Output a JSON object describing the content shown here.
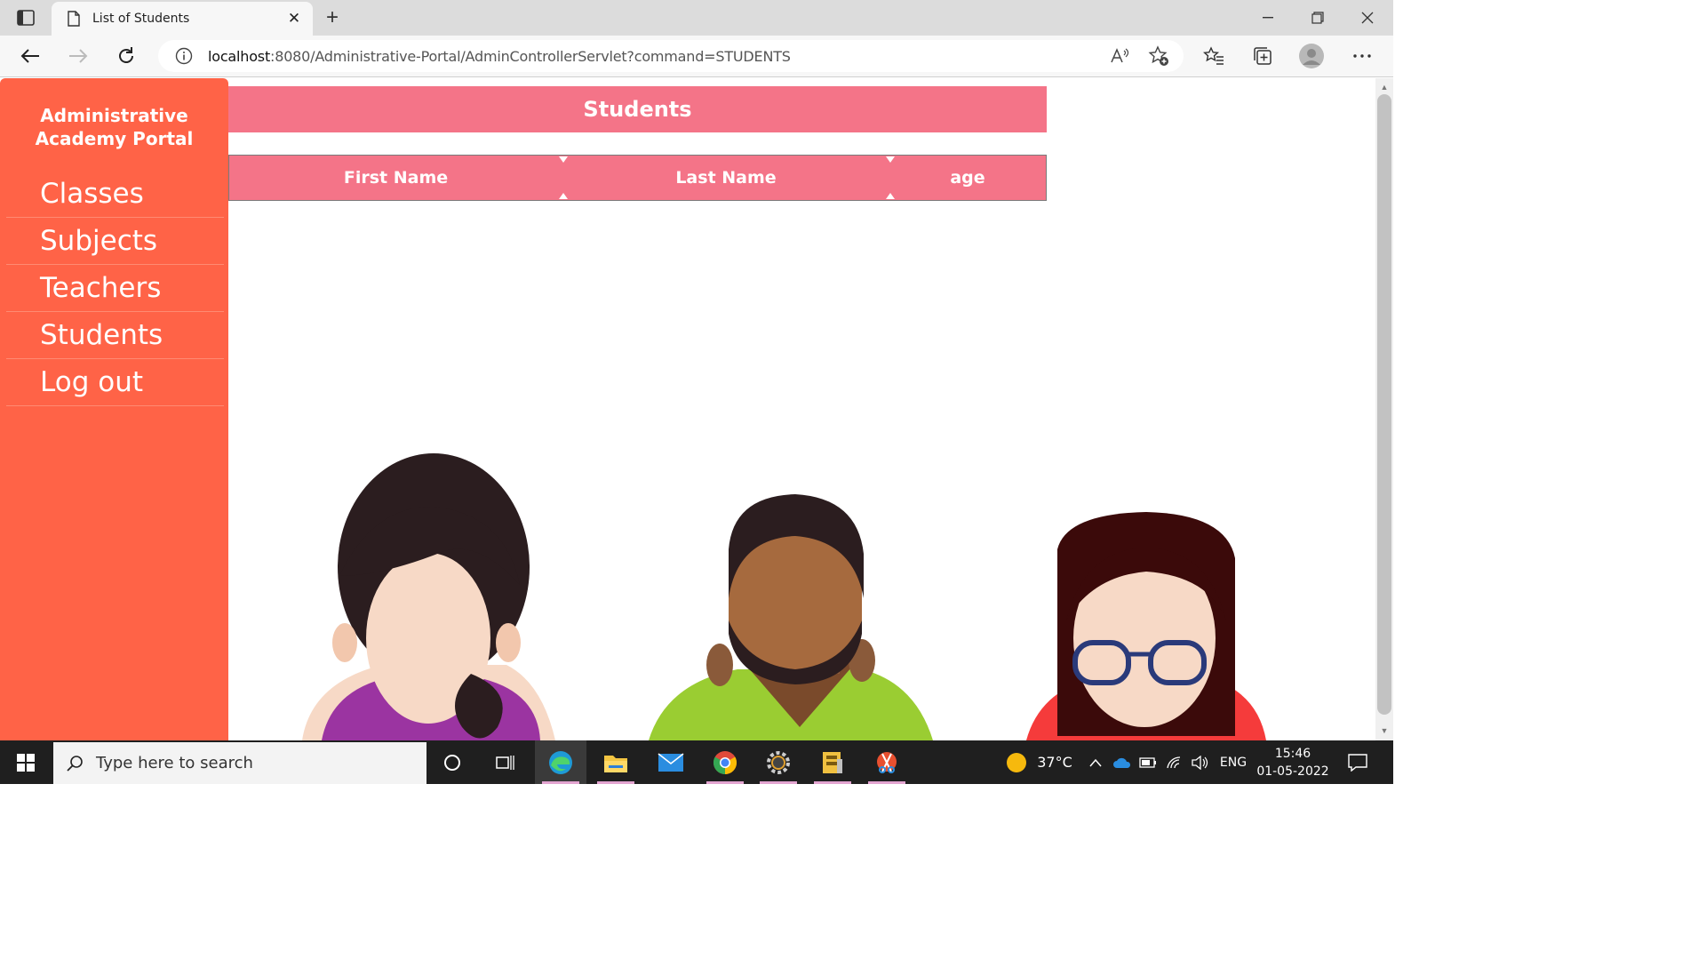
{
  "browser": {
    "tab_title": "List of Students",
    "url_host": "localhost",
    "url_rest": ":8080/Administrative-Portal/AdminControllerServlet?command=STUDENTS"
  },
  "sidebar": {
    "brand_line1": "Administrative",
    "brand_line2": "Academy Portal",
    "items": [
      {
        "label": "Classes"
      },
      {
        "label": "Subjects"
      },
      {
        "label": "Teachers"
      },
      {
        "label": "Students"
      },
      {
        "label": "Log out"
      }
    ]
  },
  "main": {
    "title": "Students",
    "columns": [
      "First Name",
      "Last Name",
      "age"
    ]
  },
  "taskbar": {
    "search_placeholder": "Type here to search",
    "temperature": "37°C",
    "language": "ENG",
    "time": "15:46",
    "date": "01-05-2022"
  },
  "colors": {
    "sidebar_bg": "#ff6347",
    "header_bg": "#f47488"
  }
}
